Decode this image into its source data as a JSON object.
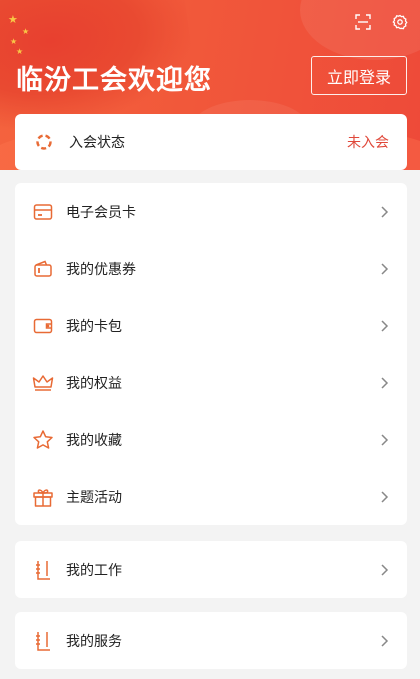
{
  "header": {
    "title": "临汾工会欢迎您",
    "login_button": "立即登录",
    "scan_icon": "scan-icon",
    "settings_icon": "gear-icon",
    "gradient_start": "#f4643e",
    "gradient_end": "#ee4a39"
  },
  "status": {
    "label": "入会状态",
    "value": "未入会",
    "value_color": "#e0483a"
  },
  "menu": {
    "items": [
      {
        "label": "电子会员卡",
        "icon": "member-card-icon"
      },
      {
        "label": "我的优惠券",
        "icon": "coupon-icon"
      },
      {
        "label": "我的卡包",
        "icon": "wallet-icon"
      },
      {
        "label": "我的权益",
        "icon": "crown-icon"
      },
      {
        "label": "我的收藏",
        "icon": "star-icon"
      },
      {
        "label": "主题活动",
        "icon": "gift-icon"
      }
    ]
  },
  "work": {
    "label": "我的工作",
    "icon": "notebook-icon"
  },
  "service": {
    "label": "我的服务",
    "icon": "notebook-icon"
  },
  "colors": {
    "accent": "#e0483a",
    "icon_orange": "#e86a35",
    "background": "#f3f3f3"
  }
}
